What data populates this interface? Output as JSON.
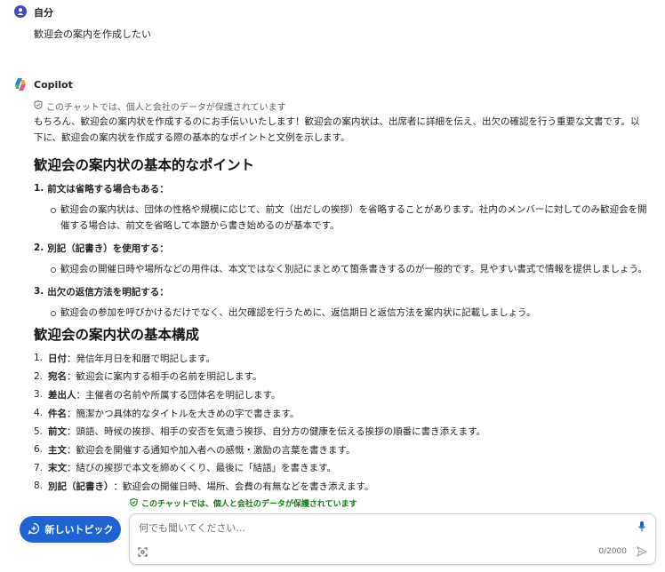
{
  "user": {
    "name": "自分",
    "message": "歓迎会の案内を作成したい"
  },
  "copilot": {
    "name": "Copilot",
    "privacy_note": "このチャットでは、個人と会社のデータが保護されています",
    "intro": "もちろん、歓迎会の案内状を作成するのにお手伝いいたします！歓迎会の案内状は、出席者に詳細を伝え、出欠の確認を行う重要な文書です。以下に、歓迎会の案内状を作成する際の基本的なポイントと文例を示します。",
    "section1": {
      "heading": "歓迎会の案内状の基本的なポイント",
      "items": [
        {
          "num": "1.",
          "title": "前文は省略する場合もある：",
          "bullet": "歓迎会の案内状は、団体の性格や規模に応じて、前文（出だしの挨拶）を省略することがあります。社内のメンバーに対してのみ歓迎会を開催する場合は、前文を省略して本題から書き始めるのが基本です。"
        },
        {
          "num": "2.",
          "title": "別記（記書き）を使用する：",
          "bullet": "歓迎会の開催日時や場所などの用件は、本文ではなく別記にまとめて箇条書きするのが一般的です。見やすい書式で情報を提供しましょう。"
        },
        {
          "num": "3.",
          "title": "出欠の返信方法を明記する：",
          "bullet": "歓迎会の参加を呼びかけるだけでなく、出欠確認を行うために、返信期日と返信方法を案内状に記載しましょう。"
        }
      ]
    },
    "section2": {
      "heading": "歓迎会の案内状の基本構成",
      "items": [
        {
          "num": "1.",
          "term": "日付",
          "desc": "：発信年月日を和暦で明記します。"
        },
        {
          "num": "2.",
          "term": "宛名",
          "desc": "：歓迎会に案内する相手の名前を明記します。"
        },
        {
          "num": "3.",
          "term": "差出人",
          "desc": "：主催者の名前や所属する団体名を明記します。"
        },
        {
          "num": "4.",
          "term": "件名",
          "desc": "：簡潔かつ具体的なタイトルを大きめの字で書きます。"
        },
        {
          "num": "5.",
          "term": "前文",
          "desc": "：頭語、時候の挨拶、相手の安否を気遣う挨拶、自分方の健康を伝える挨拶の順番に書き添えます。"
        },
        {
          "num": "6.",
          "term": "主文",
          "desc": "：歓迎会を開催する通知や加入者への感慨・激励の言葉を書きます。"
        },
        {
          "num": "7.",
          "term": "末文",
          "desc": "：結びの挨拶で本文を締めくくり、最後に「結語」を書きます。"
        },
        {
          "num": "8.",
          "term": "別記（記書き）",
          "desc": "：歓迎会の開催日時、場所、会費の有無などを書き添えます。"
        }
      ]
    }
  },
  "composer": {
    "protection_notice": "このチャットでは、個人と会社のデータが保護されています",
    "new_topic_label": "新しいトピック",
    "placeholder": "何でも聞いてください...",
    "char_counter": "0/2000"
  },
  "colors": {
    "accent": "#1f62d6",
    "notice_green": "#107c10"
  },
  "icons": {
    "user": "person-icon",
    "copilot": "copilot-logo-icon",
    "shield": "shield-check-icon",
    "new_topic": "chat-add-icon",
    "mic": "microphone-icon",
    "scan": "image-scan-icon",
    "send": "send-icon"
  }
}
